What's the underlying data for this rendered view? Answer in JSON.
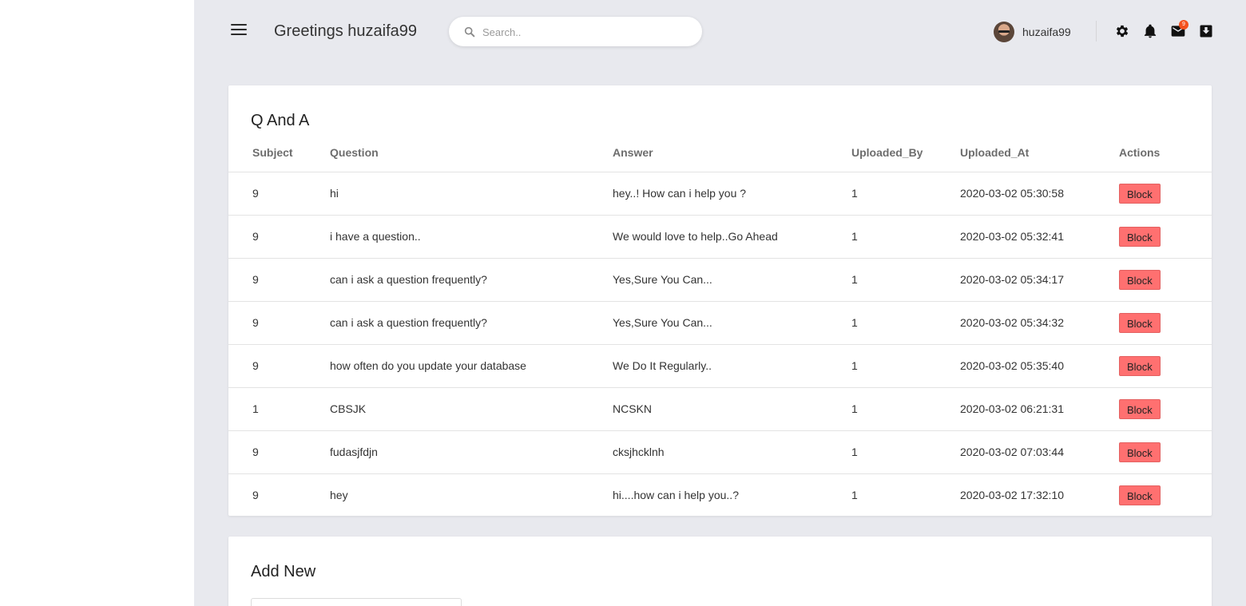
{
  "header": {
    "greeting": "Greetings huzaifa99",
    "search_placeholder": "Search..",
    "username": "huzaifa99",
    "mail_badge": "9"
  },
  "qa": {
    "title": "Q And A",
    "columns": [
      "Subject",
      "Question",
      "Answer",
      "Uploaded_By",
      "Uploaded_At",
      "Actions"
    ],
    "rows": [
      {
        "subject": "9",
        "question": "hi",
        "answer": "hey..! How can i help you ?",
        "uploaded_by": "1",
        "uploaded_at": "2020-03-02 05:30:58",
        "action": "Block"
      },
      {
        "subject": "9",
        "question": "i have a question..",
        "answer": "We would love to help..Go Ahead",
        "uploaded_by": "1",
        "uploaded_at": "2020-03-02 05:32:41",
        "action": "Block"
      },
      {
        "subject": "9",
        "question": "can i ask a question frequently?",
        "answer": "Yes,Sure You Can...",
        "uploaded_by": "1",
        "uploaded_at": "2020-03-02 05:34:17",
        "action": "Block"
      },
      {
        "subject": "9",
        "question": "can i ask a question frequently?",
        "answer": "Yes,Sure You Can...",
        "uploaded_by": "1",
        "uploaded_at": "2020-03-02 05:34:32",
        "action": "Block"
      },
      {
        "subject": "9",
        "question": "how often do you update your database",
        "answer": "We Do It Regularly..",
        "uploaded_by": "1",
        "uploaded_at": "2020-03-02 05:35:40",
        "action": "Block"
      },
      {
        "subject": "1",
        "question": "CBSJK",
        "answer": "NCSKN",
        "uploaded_by": "1",
        "uploaded_at": "2020-03-02 06:21:31",
        "action": "Block"
      },
      {
        "subject": "9",
        "question": "fudasjfdjn",
        "answer": "cksjhcklnh",
        "uploaded_by": "1",
        "uploaded_at": "2020-03-02 07:03:44",
        "action": "Block"
      },
      {
        "subject": "9",
        "question": "hey",
        "answer": "hi....how can i help you..?",
        "uploaded_by": "1",
        "uploaded_at": "2020-03-02 17:32:10",
        "action": "Block"
      }
    ]
  },
  "add_new": {
    "title": "Add New"
  },
  "colors": {
    "background": "#e8e9ee",
    "block_button": "#ff7070",
    "badge": "#f4511e"
  },
  "icons": [
    "menu-icon",
    "search-icon",
    "gear-icon",
    "bell-icon",
    "mail-icon",
    "download-icon"
  ]
}
